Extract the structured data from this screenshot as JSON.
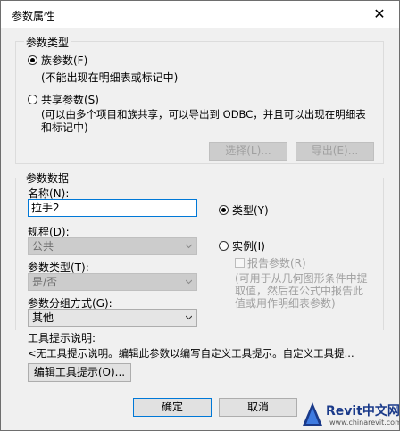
{
  "window": {
    "title": "参数属性",
    "close_glyph": "✕"
  },
  "param_type_group": {
    "legend": "参数类型",
    "family_radio_label": "族参数(F)",
    "family_note": "(不能出现在明细表或标记中)",
    "shared_radio_label": "共享参数(S)",
    "shared_note_line1": "(可以由多个项目和族共享，可以导出到 ODBC，并且可以出现在明细表",
    "shared_note_line2": "和标记中)",
    "select_button": "选择(L)...",
    "export_button": "导出(E)...",
    "selected": "family"
  },
  "param_data_group": {
    "legend": "参数数据",
    "name_label": "名称(N):",
    "name_value": "拉手2",
    "type_radio_label": "类型(Y)",
    "instance_radio_label": "实例(I)",
    "selected": "type",
    "discipline_label": "规程(D):",
    "discipline_value": "公共",
    "param_type_label": "参数类型(T):",
    "param_type_value": "是/否",
    "reporting_checkbox_label": "报告参数(R)",
    "reporting_checked": false,
    "reporting_note_line1": "(可用于从几何图形条件中提",
    "reporting_note_line2": "取值，然后在公式中报告此",
    "reporting_note_line3": "值或用作明细表参数)",
    "group_label": "参数分组方式(G):",
    "group_value": "其他"
  },
  "tooltip": {
    "label": "工具提示说明:",
    "text": "<无工具提示说明。编辑此参数以编写自定义工具提示。自定义工具提...",
    "edit_button": "编辑工具提示(O)..."
  },
  "buttons": {
    "ok": "确定",
    "cancel": "取消"
  },
  "watermark": {
    "brand": "Revit中文网",
    "url": "www.chinarevit.com"
  },
  "colors": {
    "accent": "#0078d7",
    "disabled_text": "#a0a0a0",
    "watermark_blue": "#1a56b8"
  }
}
